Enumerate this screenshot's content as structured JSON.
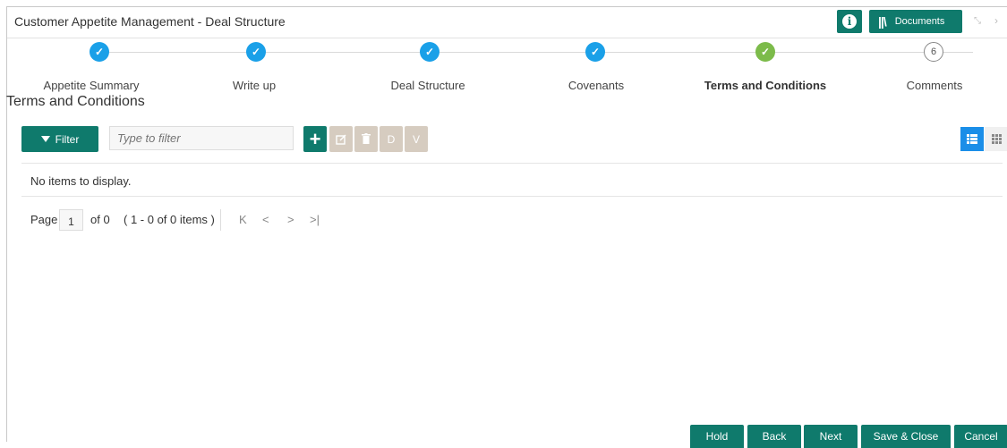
{
  "header": {
    "title": "Customer Appetite Management - Deal Structure",
    "info_icon": "info-icon",
    "documents_label": "Documents"
  },
  "stepper": {
    "steps": [
      {
        "label": "Appetite Summary",
        "state": "done"
      },
      {
        "label": "Write up",
        "state": "done"
      },
      {
        "label": "Deal Structure",
        "state": "done"
      },
      {
        "label": "Covenants",
        "state": "done"
      },
      {
        "label": "Terms and Conditions",
        "state": "current"
      },
      {
        "label": "Comments",
        "state": "pending",
        "number": "6"
      }
    ]
  },
  "section": {
    "title": "Terms and Conditions"
  },
  "toolbar": {
    "filter_label": "Filter",
    "filter_placeholder": "Type to filter",
    "d_label": "D",
    "v_label": "V"
  },
  "grid": {
    "empty_message": "No items to display."
  },
  "pager": {
    "page_label": "Page",
    "page_value": "1",
    "of_label": "of 0",
    "items_label": "( 1 - 0 of 0 items )"
  },
  "footer": {
    "hold": "Hold",
    "back": "Back",
    "next": "Next",
    "save_close": "Save & Close",
    "cancel": "Cancel"
  },
  "colors": {
    "primary": "#0f7a6c",
    "step_done": "#1aa0e8",
    "step_current": "#7cbb4a",
    "view_active": "#1a8ee8",
    "disabled": "#d6ccc0"
  }
}
